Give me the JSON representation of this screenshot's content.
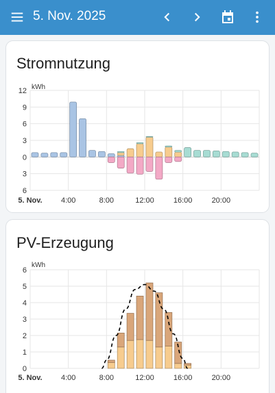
{
  "header": {
    "date": "5. Nov. 2025",
    "menu_icon": "menu-icon",
    "prev_icon": "chevron-left-icon",
    "next_icon": "chevron-right-icon",
    "calendar_icon": "calendar-icon",
    "more_icon": "more-vertical-icon",
    "background": "#3a8fcc"
  },
  "cards": [
    {
      "title": "Stromnutzung"
    },
    {
      "title": "PV-Erzeugung"
    }
  ],
  "chart_data": [
    {
      "type": "bar",
      "title": "Stromnutzung",
      "ylabel": "kWh",
      "ylim": [
        -6,
        12
      ],
      "y_ticks": [
        "12",
        "9",
        "6",
        "3",
        "0",
        "3",
        "6"
      ],
      "x_ticks": [
        "5. Nov.",
        "4:00",
        "8:00",
        "12:00",
        "16:00",
        "20:00"
      ],
      "grid": true,
      "colors": {
        "grid_import": "#a9c4e4",
        "solar_direct": "#f7cc8e",
        "battery_charge": "#f3a9c6",
        "battery_discharge": "#a7dcd3",
        "export": "#cfe7b6"
      },
      "hours": [
        0,
        1,
        2,
        3,
        4,
        5,
        6,
        7,
        8,
        9,
        10,
        11,
        12,
        13,
        14,
        15,
        16,
        17,
        18,
        19,
        20,
        21,
        22,
        23
      ],
      "series": [
        {
          "key": "grid_import",
          "values": [
            0.8,
            0.7,
            0.8,
            0.8,
            9.9,
            6.9,
            1.2,
            1.0,
            0.6,
            0.3,
            0,
            0,
            0,
            0,
            0,
            0,
            0,
            0,
            0,
            0,
            0,
            0,
            0,
            0
          ]
        },
        {
          "key": "solar_direct",
          "values": [
            0,
            0,
            0,
            0,
            0,
            0,
            0,
            0,
            0,
            0.5,
            1.5,
            2.4,
            3.6,
            0.9,
            1.8,
            0.9,
            0,
            0,
            0,
            0,
            0,
            0,
            0,
            0
          ]
        },
        {
          "key": "battery_discharge",
          "values": [
            0,
            0,
            0,
            0,
            0,
            0,
            0,
            0,
            0,
            0.2,
            0,
            0.2,
            0.1,
            0,
            0.2,
            0.3,
            1.7,
            1.2,
            1.2,
            1.1,
            1.0,
            0.9,
            0.8,
            0.7
          ]
        },
        {
          "key": "battery_charge",
          "values": [
            0,
            0,
            0,
            0,
            0,
            0,
            0,
            0,
            -1.0,
            -2.0,
            -2.9,
            -3.1,
            -2.6,
            -4.0,
            -1.0,
            -0.8,
            0,
            0,
            0,
            0,
            0,
            0,
            0,
            0
          ]
        }
      ]
    },
    {
      "type": "bar",
      "title": "PV-Erzeugung",
      "ylabel": "kWh",
      "ylim": [
        0,
        6
      ],
      "y_ticks": [
        "6",
        "5",
        "4",
        "3",
        "2",
        "1",
        "0"
      ],
      "x_ticks": [
        "5. Nov.",
        "4:00",
        "8:00",
        "12:00",
        "16:00",
        "20:00"
      ],
      "grid": true,
      "colors": {
        "pv_lower": "#f7cc8e",
        "pv_upper": "#d9a67a",
        "forecast": "#000000"
      },
      "hours": [
        8,
        9,
        10,
        11,
        12,
        13,
        14,
        15,
        16
      ],
      "series": [
        {
          "key": "pv_lower",
          "values": [
            0.35,
            1.3,
            1.7,
            1.75,
            1.7,
            1.3,
            1.35,
            0.3,
            0.2
          ]
        },
        {
          "key": "pv_upper",
          "values": [
            0.15,
            0.85,
            1.65,
            2.65,
            3.5,
            3.3,
            2.05,
            1.3,
            0.1
          ]
        }
      ],
      "forecast": {
        "x": [
          7.5,
          8,
          9,
          10,
          11,
          12,
          13,
          14,
          15,
          16,
          16.5
        ],
        "y": [
          0,
          0.5,
          2.0,
          3.6,
          4.8,
          5.1,
          4.7,
          3.6,
          2.1,
          0.6,
          0
        ]
      }
    }
  ]
}
